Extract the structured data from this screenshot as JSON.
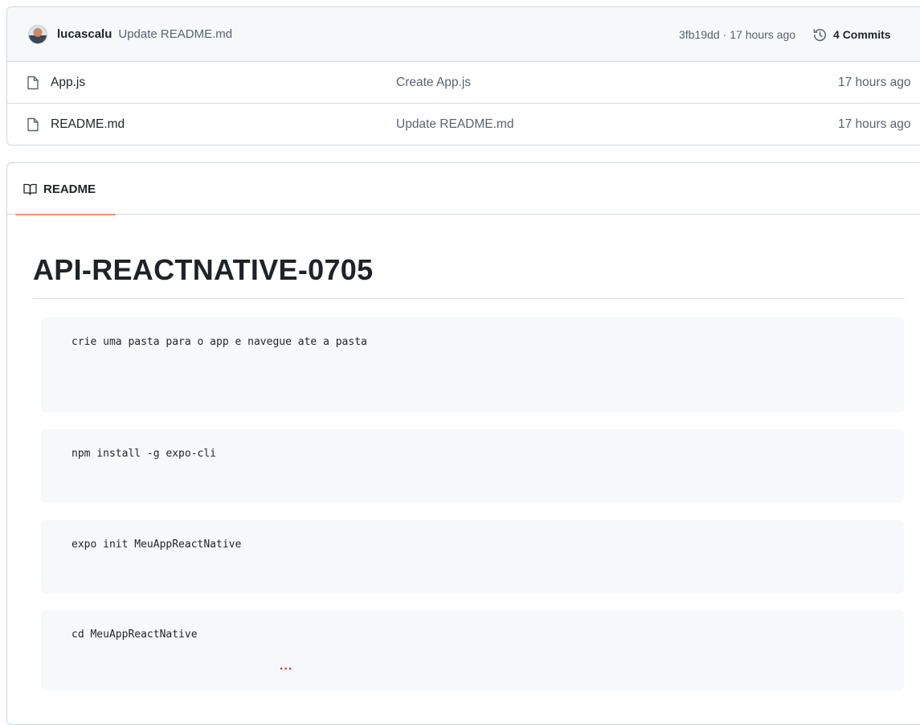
{
  "latest_commit": {
    "author": "lucascalu",
    "message": "Update README.md",
    "hash": "3fb19dd",
    "separator": "·",
    "time": "17 hours ago",
    "commits_count_label": "4 Commits"
  },
  "files": [
    {
      "name": "App.js",
      "commit_message": "Create App.js",
      "age": "17 hours ago"
    },
    {
      "name": "README.md",
      "commit_message": "Update README.md",
      "age": "17 hours ago"
    }
  ],
  "readme": {
    "tab_label": "README",
    "title": "API-REACTNATIVE-0705",
    "code_blocks": [
      "crie uma pasta para o app e navegue ate a pasta",
      "npm install -g expo-cli",
      "expo init MeuAppReactNative",
      "cd MeuAppReactNative"
    ]
  },
  "overflow_indicator": "...",
  "colors": {
    "accent_underline": "#fd8c73",
    "border": "#d0d7de",
    "code_bg": "#f6f8fa",
    "muted_text": "#59636e",
    "dots": "#e5342b"
  },
  "icons": [
    "avatar",
    "history-icon",
    "file-icon",
    "book-icon"
  ]
}
